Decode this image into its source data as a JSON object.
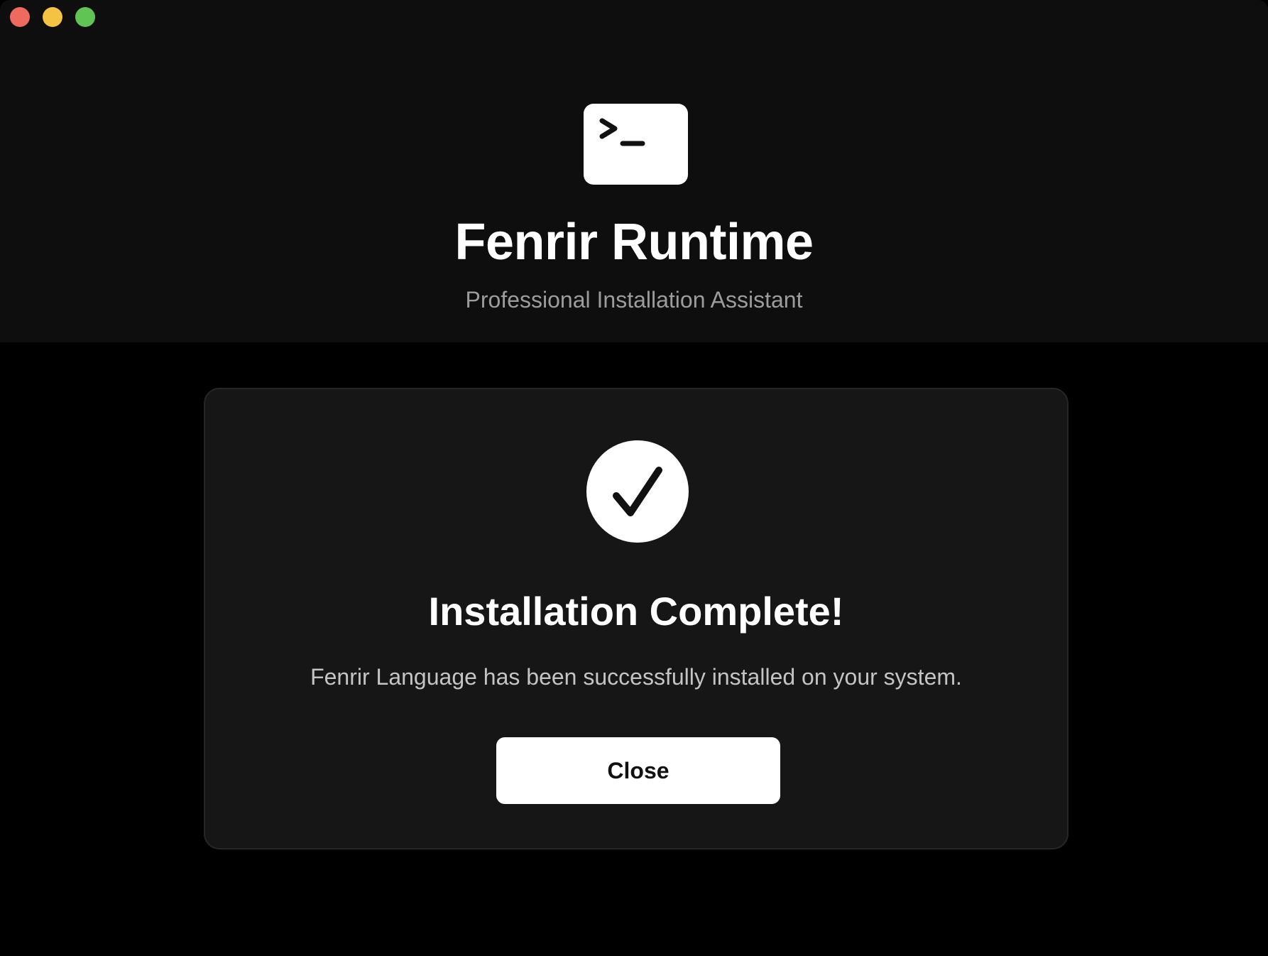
{
  "window": {
    "traffic_lights": [
      {
        "name": "close",
        "color": "#ee6a5f"
      },
      {
        "name": "minimize",
        "color": "#f5c343"
      },
      {
        "name": "zoom",
        "color": "#60c454"
      }
    ]
  },
  "header": {
    "icon": "terminal-prompt-icon",
    "title": "Fenrir Runtime",
    "subtitle": "Professional Installation Assistant"
  },
  "completion": {
    "icon": "checkmark-circle-icon",
    "title": "Installation Complete!",
    "message": "Fenrir Language has been successfully installed on your system.",
    "close_label": "Close"
  },
  "colors": {
    "header_bg": "#0e0e0e",
    "window_bg": "#000000",
    "card_bg": "#161616",
    "accent": "#ffffff"
  }
}
